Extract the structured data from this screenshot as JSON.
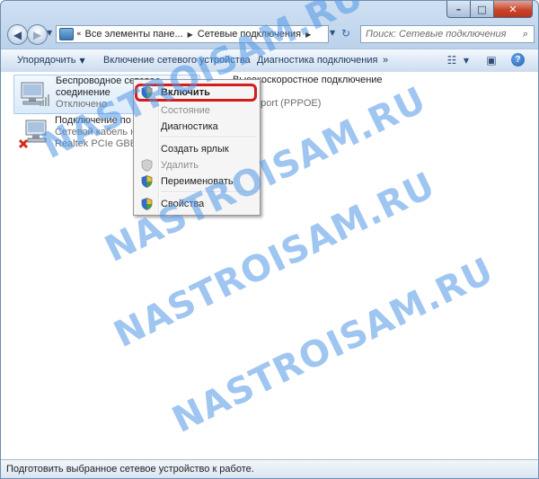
{
  "window": {
    "caption_buttons": {
      "minimize": "–",
      "maximize": "□",
      "close": "✕"
    }
  },
  "nav": {
    "breadcrumb_overflow": "«",
    "breadcrumbs": [
      "Все элементы пане...",
      "Сетевые подключения"
    ],
    "search_placeholder": "Поиск: Сетевые подключения"
  },
  "toolbar": {
    "organize": "Упорядочить",
    "enable_device": "Включение сетевого устройства",
    "diagnose": "Диагностика подключения",
    "more": "»"
  },
  "connections": [
    {
      "name": "Беспроводное сетевое",
      "name2": "соединение",
      "status": "Отключено",
      "icon": "wireless-adapter-icon"
    },
    {
      "name": "Подключение по л",
      "status": "Сетевой кабель не",
      "device": "Realtek PCIe GBE Fa",
      "icon": "ethernet-adapter-icon"
    },
    {
      "name": "Высокоскоростное подключение",
      "device": "N Miniport (PPPOE)",
      "icon": "broadband-connection-icon"
    }
  ],
  "context_menu": {
    "items": [
      {
        "label": "Включить",
        "disabled": false,
        "bold": true,
        "shield": true
      },
      {
        "label": "Состояние",
        "disabled": true,
        "bold": false,
        "shield": false
      },
      {
        "label": "Диагностика",
        "disabled": false,
        "bold": false,
        "shield": false
      },
      {
        "label": "Создать ярлык",
        "disabled": false,
        "bold": false,
        "shield": false
      },
      {
        "label": "Удалить",
        "disabled": true,
        "bold": false,
        "shield": true
      },
      {
        "label": "Переименовать",
        "disabled": false,
        "bold": false,
        "shield": true
      },
      {
        "label": "Свойства",
        "disabled": false,
        "bold": false,
        "shield": true
      }
    ],
    "highlight_color": "#d21d1d"
  },
  "status_bar": {
    "text": "Подготовить выбранное сетевое устройство к работе."
  },
  "watermark": "NASTROISAM.RU",
  "colors": {
    "accent": "#1e395b",
    "selection": "#dbeaf9"
  }
}
